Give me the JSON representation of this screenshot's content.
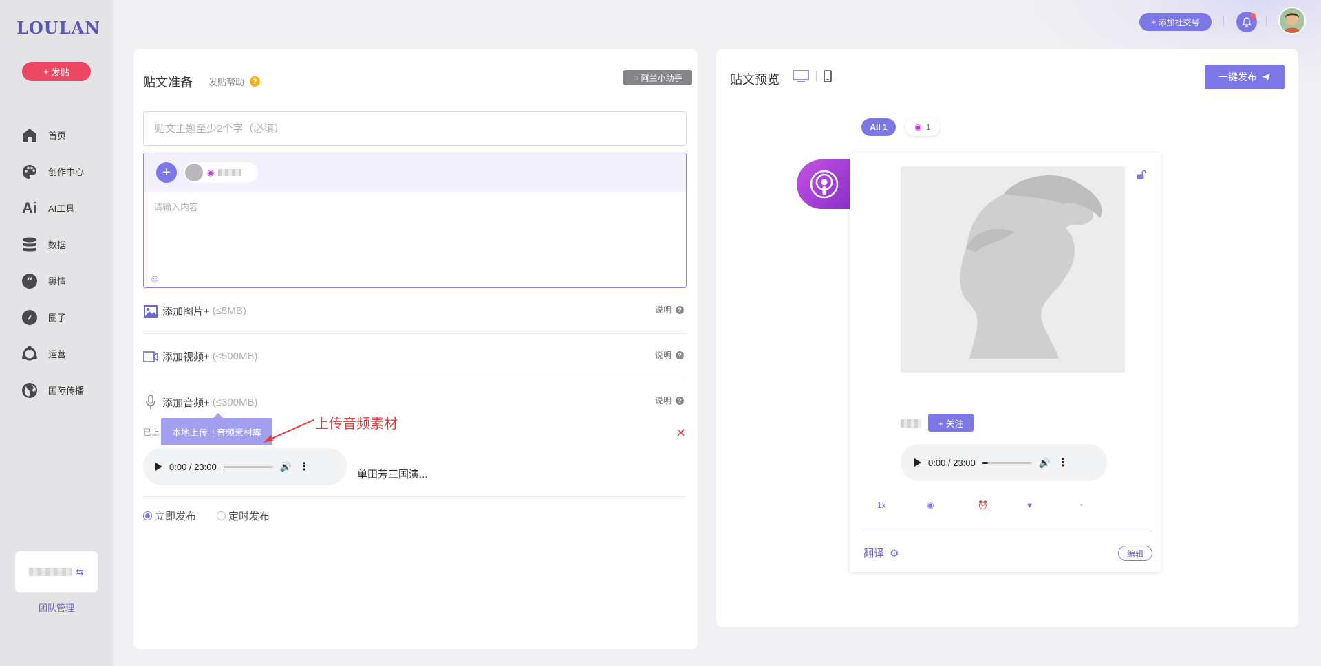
{
  "sidebar": {
    "logo": "LOULAN",
    "post_button": "发贴",
    "items": [
      {
        "label": "首页",
        "icon": "home-icon"
      },
      {
        "label": "创作中心",
        "icon": "palette-icon"
      },
      {
        "label": "AI工具",
        "icon": "ai-icon"
      },
      {
        "label": "数据",
        "icon": "database-icon"
      },
      {
        "label": "舆情",
        "icon": "quote-icon"
      },
      {
        "label": "圈子",
        "icon": "compass-icon"
      },
      {
        "label": "运营",
        "icon": "network-icon"
      },
      {
        "label": "国际传播",
        "icon": "globe-icon"
      }
    ],
    "team_label": "团队管理"
  },
  "topbar": {
    "add_social": "添加社交号"
  },
  "editor": {
    "title": "贴文准备",
    "help": "发贴帮助",
    "assistant": "阿兰小助手",
    "title_placeholder": "贴文主题至少2个字（必填）",
    "content_placeholder": "请输入内容",
    "media": {
      "image_label": "添加图片+",
      "image_limit": "(≤5MB)",
      "video_label": "添加视频+",
      "video_limit": "(≤500MB)",
      "audio_label": "添加音频+",
      "audio_limit": "(≤300MB)",
      "note": "说明"
    },
    "uploaded_label": "已上",
    "upload_popup": {
      "local": "本地上传",
      "library": "| 音频素材库"
    },
    "annotation": "上传音频素材",
    "audio": {
      "time": "0:00 / 23:00",
      "progress": 0.02,
      "name": "单田芳三国演..."
    },
    "publish": {
      "now": "立即发布",
      "scheduled": "定时发布",
      "selected": "now"
    }
  },
  "preview": {
    "title": "贴文预览",
    "one_click": "一键发布",
    "filter_all": "All 1",
    "filter_pod_count": "1",
    "follow": "+ 关注",
    "audio": {
      "time": "0:00 / 23:00",
      "progress": 0.12
    },
    "speed": "1x",
    "translate": "翻译",
    "edit": "编辑"
  },
  "colors": {
    "accent": "#7b77e6",
    "post_button": "#ec4863",
    "annotation": "#e53c3c",
    "podcast": "#b043d8"
  }
}
